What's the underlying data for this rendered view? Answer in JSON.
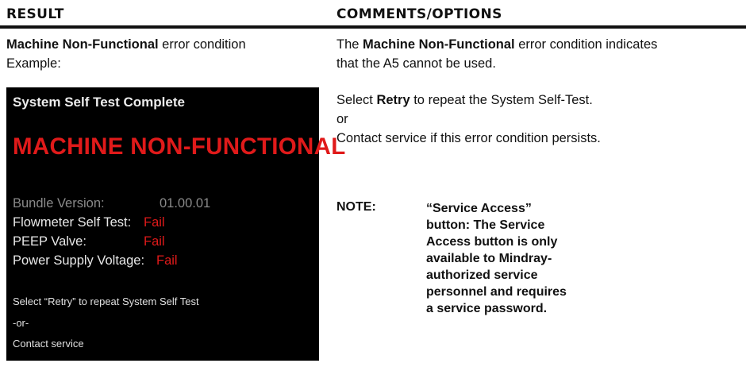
{
  "header": {
    "result_title": "RESULT",
    "comments_title": "COMMENTS/OPTIONS"
  },
  "left": {
    "line1_bold": "Machine Non-Functional",
    "line1_rest": " error condition",
    "line2": "Example:"
  },
  "screen": {
    "title": "System Self Test Complete",
    "big_message": "MACHINE NON-FUNCTIONAL",
    "rows": [
      {
        "label": "Bundle Version:",
        "value": "01.00.01"
      },
      {
        "label": "Flowmeter Self Test:",
        "value": "Fail"
      },
      {
        "label": "PEEP Valve:",
        "value": "Fail"
      },
      {
        "label": "Power Supply Voltage:",
        "value": "Fail"
      }
    ],
    "instructions": [
      "Select “Retry” to repeat System Self Test",
      "-or-",
      "Contact service"
    ]
  },
  "right": {
    "p1_pre": "The ",
    "p1_bold": "Machine Non-Functional",
    "p1_post": " error condition indicates",
    "p1_line2": "that the A5 cannot be used.",
    "p2_pre": "Select ",
    "p2_bold": "Retry",
    "p2_post": " to repeat the System Self-Test.",
    "p3": "or",
    "p4": "Contact service if this error condition persists.",
    "note_label": "NOTE:",
    "note_lines": [
      "“Service Access”",
      "button: The Service",
      "Access button is only",
      "available to Mindray-",
      "authorized service",
      "personnel and requires",
      "a service password."
    ]
  }
}
